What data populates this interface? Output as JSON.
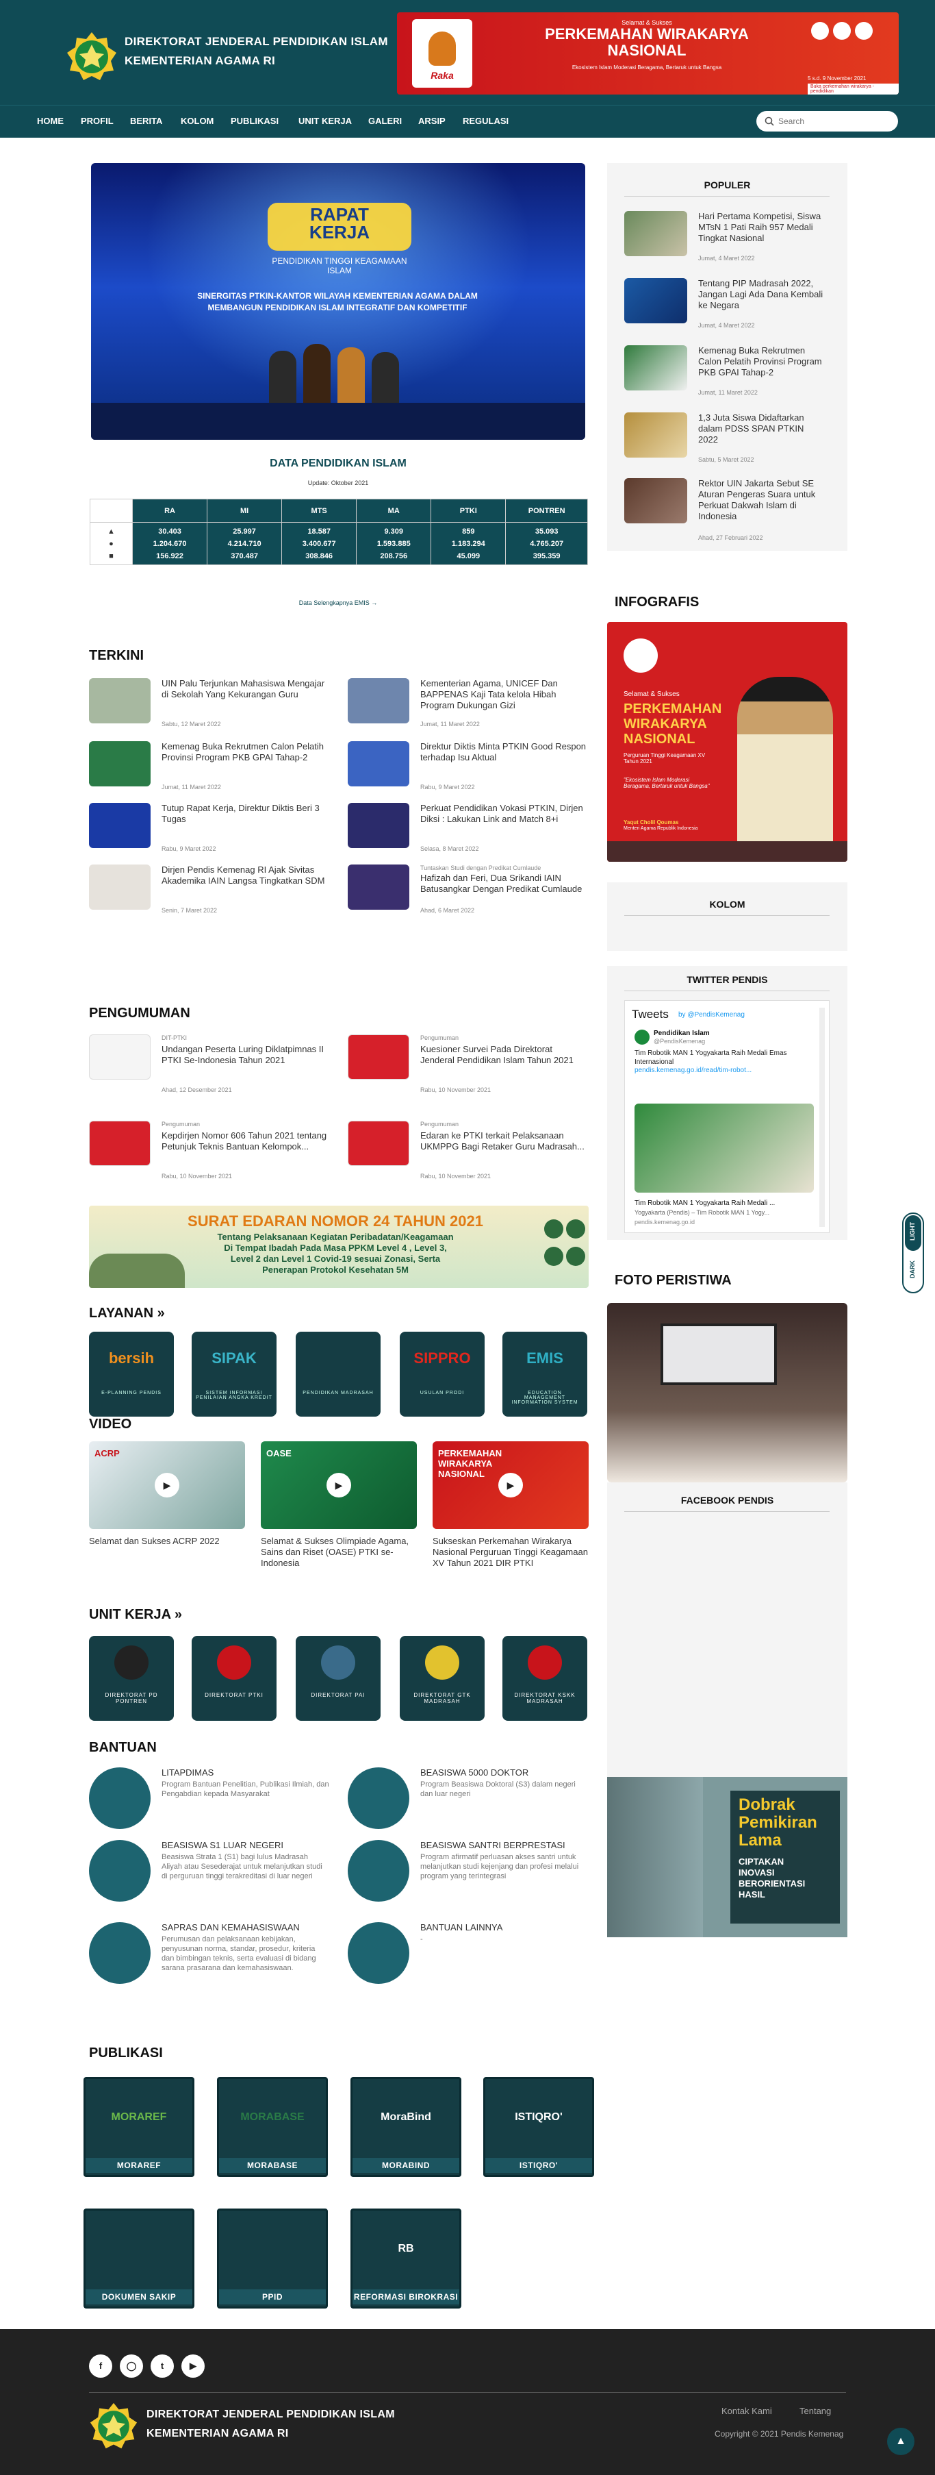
{
  "brand": {
    "line1": "DIREKTORAT JENDERAL PENDIDIKAN ISLAM",
    "line2": "KEMENTERIAN AGAMA RI"
  },
  "banner": {
    "small": "Selamat & Sukses",
    "title1": "PERKEMAHAN WIRAKARYA",
    "title2": "NASIONAL",
    "sub": "Ekosistem Islam Moderasi Beragama, Bertaruk untuk Bangsa",
    "date": "5 s.d. 9 November 2021",
    "tag": "Buka perkemahan wirakarya - pendidikan",
    "mascot": "Raka"
  },
  "nav": [
    "HOME",
    "PROFIL",
    "BERITA",
    "KOLOM",
    "PUBLIKASI",
    "UNIT KERJA",
    "GALERI",
    "ARSIP",
    "REGULASI"
  ],
  "search": {
    "placeholder": "Search"
  },
  "hero": {
    "caption1": "RAPAT",
    "caption2": "KERJA",
    "caption3": "PENDIDIKAN TINGGI KEAGAMAAN ISLAM",
    "caption4": "SINERGITAS PTKIN-KANTOR WILAYAH KEMENTERIAN AGAMA DALAM MEMBANGUN PENDIDIKAN ISLAM INTEGRATIF DAN KOMPETITIF"
  },
  "data_pendidikan": {
    "title": "DATA PENDIDIKAN ISLAM",
    "update": "Update: Oktober 2021",
    "link": "Data Selengkapnya EMIS →",
    "columns": [
      "RA",
      "MI",
      "MTS",
      "MA",
      "PTKI",
      "PONTREN"
    ],
    "rows": [
      [
        "30.403",
        "25.997",
        "18.587",
        "9.309",
        "859",
        "35.093"
      ],
      [
        "1.204.670",
        "4.214.710",
        "3.400.677",
        "1.593.885",
        "1.183.294",
        "4.765.207"
      ],
      [
        "156.922",
        "370.487",
        "308.846",
        "208.756",
        "45.099",
        "395.359"
      ]
    ]
  },
  "populer": {
    "title": "POPULER",
    "items": [
      {
        "title": "Hari Pertama Kompetisi, Siswa MTsN 1 Pati Raih 957 Medali Tingkat Nasional",
        "date": "Jumat, 4 Maret 2022"
      },
      {
        "title": "Tentang PIP Madrasah 2022, Jangan Lagi Ada Dana Kembali ke Negara",
        "date": "Jumat, 4 Maret 2022"
      },
      {
        "title": "Kemenag Buka Rekrutmen Calon Pelatih Provinsi Program PKB GPAI Tahap-2",
        "date": "Jumat, 11 Maret 2022"
      },
      {
        "title": "1,3 Juta Siswa Didaftarkan dalam PDSS SPAN PTKIN 2022",
        "date": "Sabtu, 5 Maret 2022"
      },
      {
        "title": "Rektor UIN Jakarta Sebut SE Aturan Pengeras Suara untuk Perkuat Dakwah Islam di Indonesia",
        "date": "Ahad, 27 Februari 2022"
      }
    ]
  },
  "infografis": {
    "title": "INFOGRAFIS",
    "small": "Selamat & Sukses",
    "title1": "PERKEMAHAN",
    "title2": "WIRAKARYA",
    "title3": "NASIONAL",
    "sub": "Perguruan Tinggi Keagamaan XV Tahun 2021",
    "theme": "\"Ekosistem Islam Moderasi Beragama, Bertaruk untuk Bangsa\"",
    "person": "Yaqut Cholil Qoumas",
    "role": "Menteri Agama Republik Indonesia"
  },
  "kolom": {
    "title": "KOLOM"
  },
  "terkini": {
    "title": "TERKINI",
    "items": [
      {
        "title": "UIN Palu Terjunkan Mahasiswa Mengajar di Sekolah Yang Kekurangan Guru",
        "date": "Sabtu, 12 Maret 2022"
      },
      {
        "title": "Kementerian Agama, UNICEF Dan BAPPENAS Kaji Tata kelola Hibah Program Dukungan Gizi",
        "date": "Jumat, 11 Maret 2022"
      },
      {
        "title": "Kemenag Buka Rekrutmen Calon Pelatih Provinsi Program PKB GPAI Tahap-2",
        "date": "Jumat, 11 Maret 2022"
      },
      {
        "title": "Direktur Diktis Minta PTKIN Good Respon terhadap Isu Aktual",
        "date": "Rabu, 9 Maret 2022"
      },
      {
        "title": "Tutup Rapat Kerja, Direktur Diktis Beri 3 Tugas",
        "date": "Rabu, 9 Maret 2022"
      },
      {
        "title": "Perkuat Pendidikan Vokasi PTKIN, Dirjen Diksi : Lakukan Link and Match 8+i",
        "date": "Selasa, 8 Maret 2022"
      },
      {
        "title": "Dirjen Pendis Kemenag RI Ajak Sivitas Akademika IAIN Langsa Tingkatkan SDM",
        "date": "Senin, 7 Maret 2022"
      },
      {
        "title": "Hafizah dan Feri, Dua Srikandi IAIN Batusangkar Dengan Predikat Cumlaude",
        "date": "Ahad, 6 Maret 2022",
        "kicker": "Tuntaskan Studi dengan Predikat Cumlaude"
      }
    ]
  },
  "pengumuman": {
    "title": "PENGUMUMAN",
    "items": [
      {
        "kicker": "DIT-PTKI",
        "title": "Undangan Peserta Luring Diklatpimnas II PTKI Se-Indonesia Tahun 2021",
        "date": "Ahad, 12 Desember 2021"
      },
      {
        "kicker": "Pengumuman",
        "title": "Kuesioner Survei Pada Direktorat Jenderal Pendidikan Islam Tahun 2021",
        "date": "Rabu, 10 November 2021"
      },
      {
        "kicker": "Pengumuman",
        "title": "Kepdirjen Nomor 606 Tahun 2021 tentang Petunjuk Teknis Bantuan Kelompok...",
        "date": "Rabu, 10 November 2021"
      },
      {
        "kicker": "Pengumuman",
        "title": "Edaran ke PTKI terkait Pelaksanaan UKMPPG Bagi Retaker Guru Madrasah...",
        "date": "Rabu, 10 November 2021"
      }
    ]
  },
  "surat": {
    "title": "SURAT EDARAN NOMOR 24 TAHUN 2021",
    "line1": "Tentang Pelaksanaan Kegiatan Peribadatan/Keagamaan",
    "line2": "Di Tempat Ibadah Pada Masa PPKM Level 4 , Level 3,",
    "line3": "Level 2 dan Level 1 Covid-19 sesuai Zonasi, Serta",
    "line4": "Penerapan Protokol Kesehatan 5M"
  },
  "layanan": {
    "title": "LAYANAN »",
    "items": [
      {
        "name": "bersih",
        "sub": "E-PLANNING PENDIS"
      },
      {
        "name": "SIPAK",
        "sub": "SISTEM INFORMASI PENILAIAN ANGKA KREDIT"
      },
      {
        "name": "",
        "sub": "PENDIDIKAN MADRASAH"
      },
      {
        "name": "SIPPRO",
        "sub": "USULAN PRODI"
      },
      {
        "name": "EMIS",
        "sub": "EDUCATION MANAGEMENT INFORMATION SYSTEM"
      }
    ]
  },
  "video": {
    "title": "VIDEO",
    "items": [
      {
        "title": "Selamat dan Sukses ACRP 2022",
        "thumb": "ACRP"
      },
      {
        "title": "Selamat & Sukses Olimpiade Agama, Sains dan Riset (OASE) PTKI se-Indonesia",
        "thumb": "OASE"
      },
      {
        "title": "Sukseskan Perkemahan Wirakarya Nasional Perguruan Tinggi Keagamaan XV Tahun 2021 DIR PTKI",
        "thumb": "PERKEMAHAN WIRAKARYA NASIONAL"
      }
    ]
  },
  "unit": {
    "title": "UNIT KERJA »",
    "items": [
      "DIREKTORAT PD PONTREN",
      "DIREKTORAT PTKI",
      "DIREKTORAT PAI",
      "DIREKTORAT GTK MADRASAH",
      "DIREKTORAT KSKK MADRASAH"
    ]
  },
  "bantuan": {
    "title": "BANTUAN",
    "items": [
      {
        "title": "LITAPDIMAS",
        "desc": "Program Bantuan Penelitian, Publikasi Ilmiah, dan Pengabdian kepada Masyarakat"
      },
      {
        "title": "BEASISWA 5000 DOKTOR",
        "desc": "Program Beasiswa Doktoral (S3) dalam negeri dan luar negeri"
      },
      {
        "title": "BEASISWA S1 LUAR NEGERI",
        "desc": "Beasiswa Strata 1 (S1) bagi lulus Madrasah Aliyah atau Sesederajat untuk melanjutkan studi di perguruan tinggi terakreditasi di luar negeri"
      },
      {
        "title": "BEASISWA SANTRI BERPRESTASI",
        "desc": "Program afirmatif perluasan akses santri untuk melanjutkan studi kejenjang dan profesi melalui program yang terintegrasi"
      },
      {
        "title": "SAPRAS DAN KEMAHASISWAAN",
        "desc": "Perumusan dan pelaksanaan kebijakan, penyusunan norma, standar, prosedur, kriteria dan bimbingan teknis, serta evaluasi di bidang sarana prasarana dan kemahasiswaan."
      },
      {
        "title": "BANTUAN LAINNYA",
        "desc": "-"
      }
    ]
  },
  "twitter": {
    "title": "TWITTER PENDIS",
    "head": "Tweets",
    "by": "by @PendisKemenag",
    "name": "Pendidikan Islam",
    "handle": "@PendisKemenag",
    "text": "Tim Robotik MAN 1 Yogyakarta Raih Medali Emas Internasional",
    "link": "pendis.kemenag.go.id/read/tim-robot...",
    "card1": "Tim Robotik MAN 1 Yogyakarta Raih Medali ...",
    "card2": "Yogyakarta (Pendis) – Tim Robotik MAN 1 Yogy...",
    "card3": "pendis.kemenag.go.id"
  },
  "foto": {
    "title": "FOTO PERISTIWA"
  },
  "facebook": {
    "title": "FACEBOOK PENDIS"
  },
  "dobrak": {
    "line1": "Dobrak",
    "line2": "Pemikiran",
    "line3": "Lama",
    "line4": "CIPTAKAN",
    "line5": "INOVASI",
    "line6": "BERORIENTASI",
    "line7": "HASIL"
  },
  "theme": {
    "light": "LIGHT",
    "dark": "DARK"
  },
  "publikasi": {
    "title": "PUBLIKASI",
    "items": [
      {
        "logo": "MORAREF",
        "label": "MORAREF"
      },
      {
        "logo": "MORABASE",
        "label": "MORABASE"
      },
      {
        "logo": "MoraBind",
        "label": "MORABIND"
      },
      {
        "logo": "ISTIQRO'",
        "label": "ISTIQRO'"
      },
      {
        "logo": "",
        "label": "DOKUMEN SAKIP"
      },
      {
        "logo": "",
        "label": "PPID"
      },
      {
        "logo": "RB",
        "label": "REFORMASI BIROKRASI"
      }
    ]
  },
  "footer": {
    "line1": "DIREKTORAT JENDERAL PENDIDIKAN ISLAM",
    "line2": "KEMENTERIAN AGAMA RI",
    "kontak": "Kontak Kami",
    "tentang": "Tentang",
    "copy": "Copyright © 2021 Pendis Kemenag",
    "social": [
      "facebook-icon",
      "instagram-icon",
      "twitter-icon",
      "youtube-icon"
    ]
  },
  "colors": {
    "primary": "#104b55",
    "accent": "#1d6470",
    "red": "#d21c1f"
  }
}
